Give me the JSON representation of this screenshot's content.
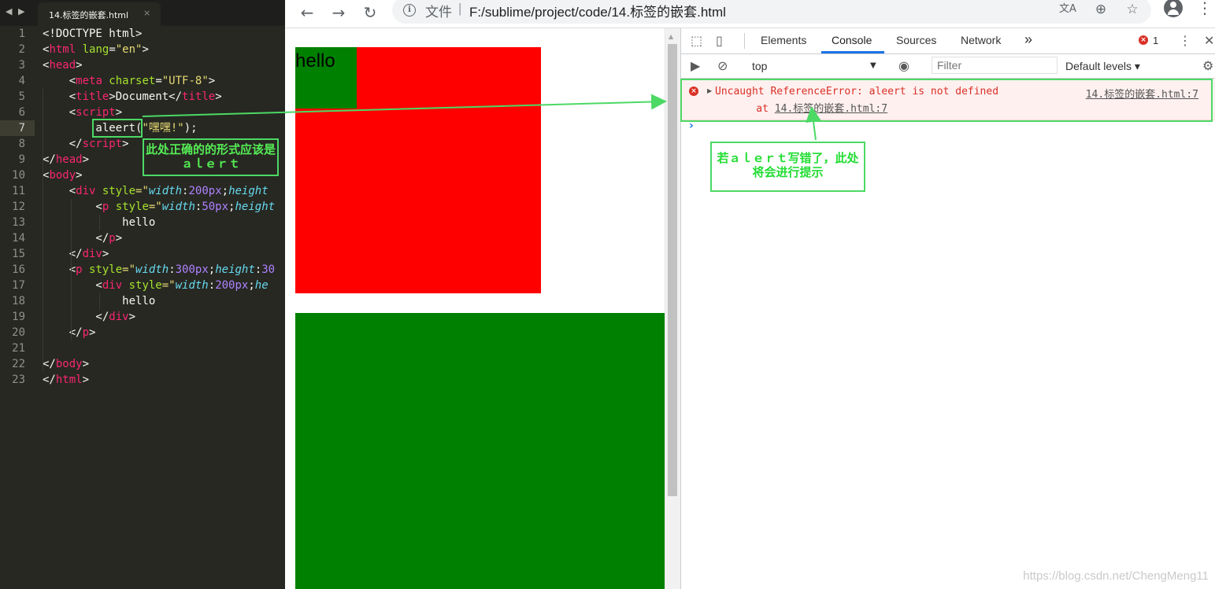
{
  "editor": {
    "tab_title": "14.标签的嵌套.html",
    "tab_close": "×",
    "nav_back": "◀",
    "nav_forward": "▶",
    "current_line": 7,
    "line_numbers": [
      "1",
      "2",
      "3",
      "4",
      "5",
      "6",
      "7",
      "8",
      "9",
      "10",
      "11",
      "12",
      "13",
      "14",
      "15",
      "16",
      "17",
      "18",
      "19",
      "20",
      "21",
      "22",
      "23"
    ],
    "lines": [
      [
        {
          "t": "<!DOCTYPE html>",
          "c": "pl"
        }
      ],
      [
        {
          "t": "<",
          "c": "pl"
        },
        {
          "t": "html",
          "c": "tg"
        },
        {
          "t": " lang",
          "c": "at"
        },
        {
          "t": "=",
          "c": "pl"
        },
        {
          "t": "\"en\"",
          "c": "st"
        },
        {
          "t": ">",
          "c": "pl"
        }
      ],
      [
        {
          "t": "<",
          "c": "pl"
        },
        {
          "t": "head",
          "c": "tg"
        },
        {
          "t": ">",
          "c": "pl"
        }
      ],
      [
        {
          "t": "    <",
          "c": "pl"
        },
        {
          "t": "meta",
          "c": "tg"
        },
        {
          "t": " charset",
          "c": "at"
        },
        {
          "t": "=",
          "c": "pl"
        },
        {
          "t": "\"UTF-8\"",
          "c": "st"
        },
        {
          "t": ">",
          "c": "pl"
        }
      ],
      [
        {
          "t": "    <",
          "c": "pl"
        },
        {
          "t": "title",
          "c": "tg"
        },
        {
          "t": ">Document</",
          "c": "pl"
        },
        {
          "t": "title",
          "c": "tg"
        },
        {
          "t": ">",
          "c": "pl"
        }
      ],
      [
        {
          "t": "    <",
          "c": "pl"
        },
        {
          "t": "script",
          "c": "tg"
        },
        {
          "t": ">",
          "c": "pl"
        }
      ],
      [
        {
          "t": "        aleert(",
          "c": "pl"
        },
        {
          "t": "\"嘿嘿!\"",
          "c": "st"
        },
        {
          "t": ");",
          "c": "pl"
        }
      ],
      [
        {
          "t": "    </",
          "c": "pl"
        },
        {
          "t": "script",
          "c": "tg"
        },
        {
          "t": ">",
          "c": "pl"
        }
      ],
      [
        {
          "t": "</",
          "c": "pl"
        },
        {
          "t": "head",
          "c": "tg"
        },
        {
          "t": ">",
          "c": "pl"
        }
      ],
      [
        {
          "t": "<",
          "c": "pl"
        },
        {
          "t": "body",
          "c": "tg"
        },
        {
          "t": ">",
          "c": "pl"
        }
      ],
      [
        {
          "t": "    <",
          "c": "pl"
        },
        {
          "t": "div",
          "c": "tg"
        },
        {
          "t": " style",
          "c": "at"
        },
        {
          "t": "=\"",
          "c": "st"
        },
        {
          "t": "width",
          "c": "cp"
        },
        {
          "t": ":",
          "c": "pl"
        },
        {
          "t": "200px",
          "c": "nm"
        },
        {
          "t": ";",
          "c": "pl"
        },
        {
          "t": "height",
          "c": "cp"
        }
      ],
      [
        {
          "t": "        <",
          "c": "pl"
        },
        {
          "t": "p",
          "c": "tg"
        },
        {
          "t": " style",
          "c": "at"
        },
        {
          "t": "=\"",
          "c": "st"
        },
        {
          "t": "width",
          "c": "cp"
        },
        {
          "t": ":",
          "c": "pl"
        },
        {
          "t": "50px",
          "c": "nm"
        },
        {
          "t": ";",
          "c": "pl"
        },
        {
          "t": "height",
          "c": "cp"
        }
      ],
      [
        {
          "t": "            hello",
          "c": "pl"
        }
      ],
      [
        {
          "t": "        </",
          "c": "pl"
        },
        {
          "t": "p",
          "c": "tg"
        },
        {
          "t": ">",
          "c": "pl"
        }
      ],
      [
        {
          "t": "    </",
          "c": "pl"
        },
        {
          "t": "div",
          "c": "tg"
        },
        {
          "t": ">",
          "c": "pl"
        }
      ],
      [
        {
          "t": "    <",
          "c": "pl"
        },
        {
          "t": "p",
          "c": "tg"
        },
        {
          "t": " style",
          "c": "at"
        },
        {
          "t": "=\"",
          "c": "st"
        },
        {
          "t": "width",
          "c": "cp"
        },
        {
          "t": ":",
          "c": "pl"
        },
        {
          "t": "300px",
          "c": "nm"
        },
        {
          "t": ";",
          "c": "pl"
        },
        {
          "t": "height",
          "c": "cp"
        },
        {
          "t": ":",
          "c": "pl"
        },
        {
          "t": "30",
          "c": "nm"
        }
      ],
      [
        {
          "t": "        <",
          "c": "pl"
        },
        {
          "t": "div",
          "c": "tg"
        },
        {
          "t": " style",
          "c": "at"
        },
        {
          "t": "=\"",
          "c": "st"
        },
        {
          "t": "width",
          "c": "cp"
        },
        {
          "t": ":",
          "c": "pl"
        },
        {
          "t": "200px",
          "c": "nm"
        },
        {
          "t": ";",
          "c": "pl"
        },
        {
          "t": "he",
          "c": "cp"
        }
      ],
      [
        {
          "t": "            hello",
          "c": "pl"
        }
      ],
      [
        {
          "t": "        </",
          "c": "pl"
        },
        {
          "t": "div",
          "c": "tg"
        },
        {
          "t": ">",
          "c": "pl"
        }
      ],
      [
        {
          "t": "    </",
          "c": "pl"
        },
        {
          "t": "p",
          "c": "tg"
        },
        {
          "t": ">",
          "c": "pl"
        }
      ],
      [],
      [
        {
          "t": "</",
          "c": "pl"
        },
        {
          "t": "body",
          "c": "tg"
        },
        {
          "t": ">",
          "c": "pl"
        }
      ],
      [
        {
          "t": "</",
          "c": "pl"
        },
        {
          "t": "html",
          "c": "tg"
        },
        {
          "t": ">",
          "c": "pl"
        }
      ]
    ]
  },
  "browser": {
    "back_icon": "←",
    "forward_icon": "→",
    "reload_icon": "↻",
    "info_icon": "i",
    "url_prefix": "文件",
    "url_separator": "|",
    "url": "F:/sublime/project/code/14.标签的嵌套.html",
    "translate_icon": "文A",
    "zoom_icon": "⊕",
    "star_icon": "☆",
    "menu_icon": "⋮"
  },
  "page": {
    "hello_text": "hello",
    "colors": {
      "outer_div": "#ff0000",
      "inner_p": "#008000",
      "lower_p": "#008000"
    }
  },
  "devtools": {
    "tabs": [
      "Elements",
      "Console",
      "Sources",
      "Network"
    ],
    "active_tab": "Console",
    "more_tabs": "»",
    "error_count": "1",
    "error_badge_icon": "×",
    "settings_icon": "⋮",
    "close_icon": "✕",
    "context": "top",
    "filter_placeholder": "Filter",
    "levels": "Default levels ▾",
    "error": {
      "message": "Uncaught ReferenceError: aleert is not defined",
      "source": "14.标签的嵌套.html:7",
      "at_prefix": "    at ",
      "at_link": "14.标签的嵌套.html:7"
    },
    "prompt": "›"
  },
  "annotations": {
    "editor_note": "此处正确的的形式应该是ａｌｅｒｔ",
    "console_note": "若ａｌｅｒｔ写错了，此处将会进行提示",
    "arrow_color": "#4cd964"
  },
  "watermark": "https://blog.csdn.net/ChengMeng11"
}
